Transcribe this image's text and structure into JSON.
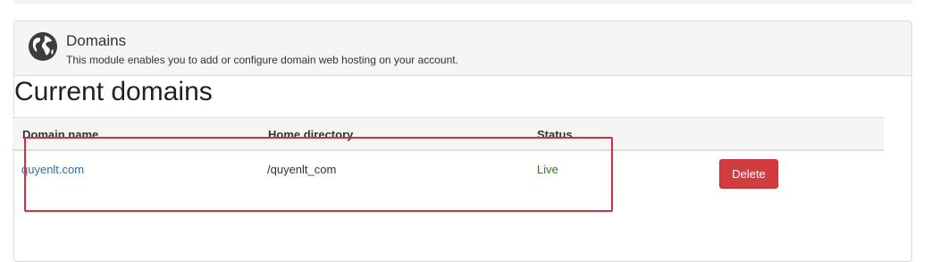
{
  "module": {
    "icon": "globe-icon",
    "title": "Domains",
    "description": "This module enables you to add or configure domain web hosting on your account."
  },
  "section_title": "Current domains",
  "table": {
    "headers": [
      "Domain name",
      "Home directory",
      "Status",
      ""
    ],
    "rows": [
      {
        "domain": "quyenlt.com",
        "home_directory": "/quyenlt_com",
        "status": "Live",
        "action_label": "Delete"
      }
    ]
  },
  "colors": {
    "link": "#2a6db0",
    "status_live": "#2e7d16",
    "delete_button": "#d03c3f",
    "highlight_box": "#d2303f"
  }
}
